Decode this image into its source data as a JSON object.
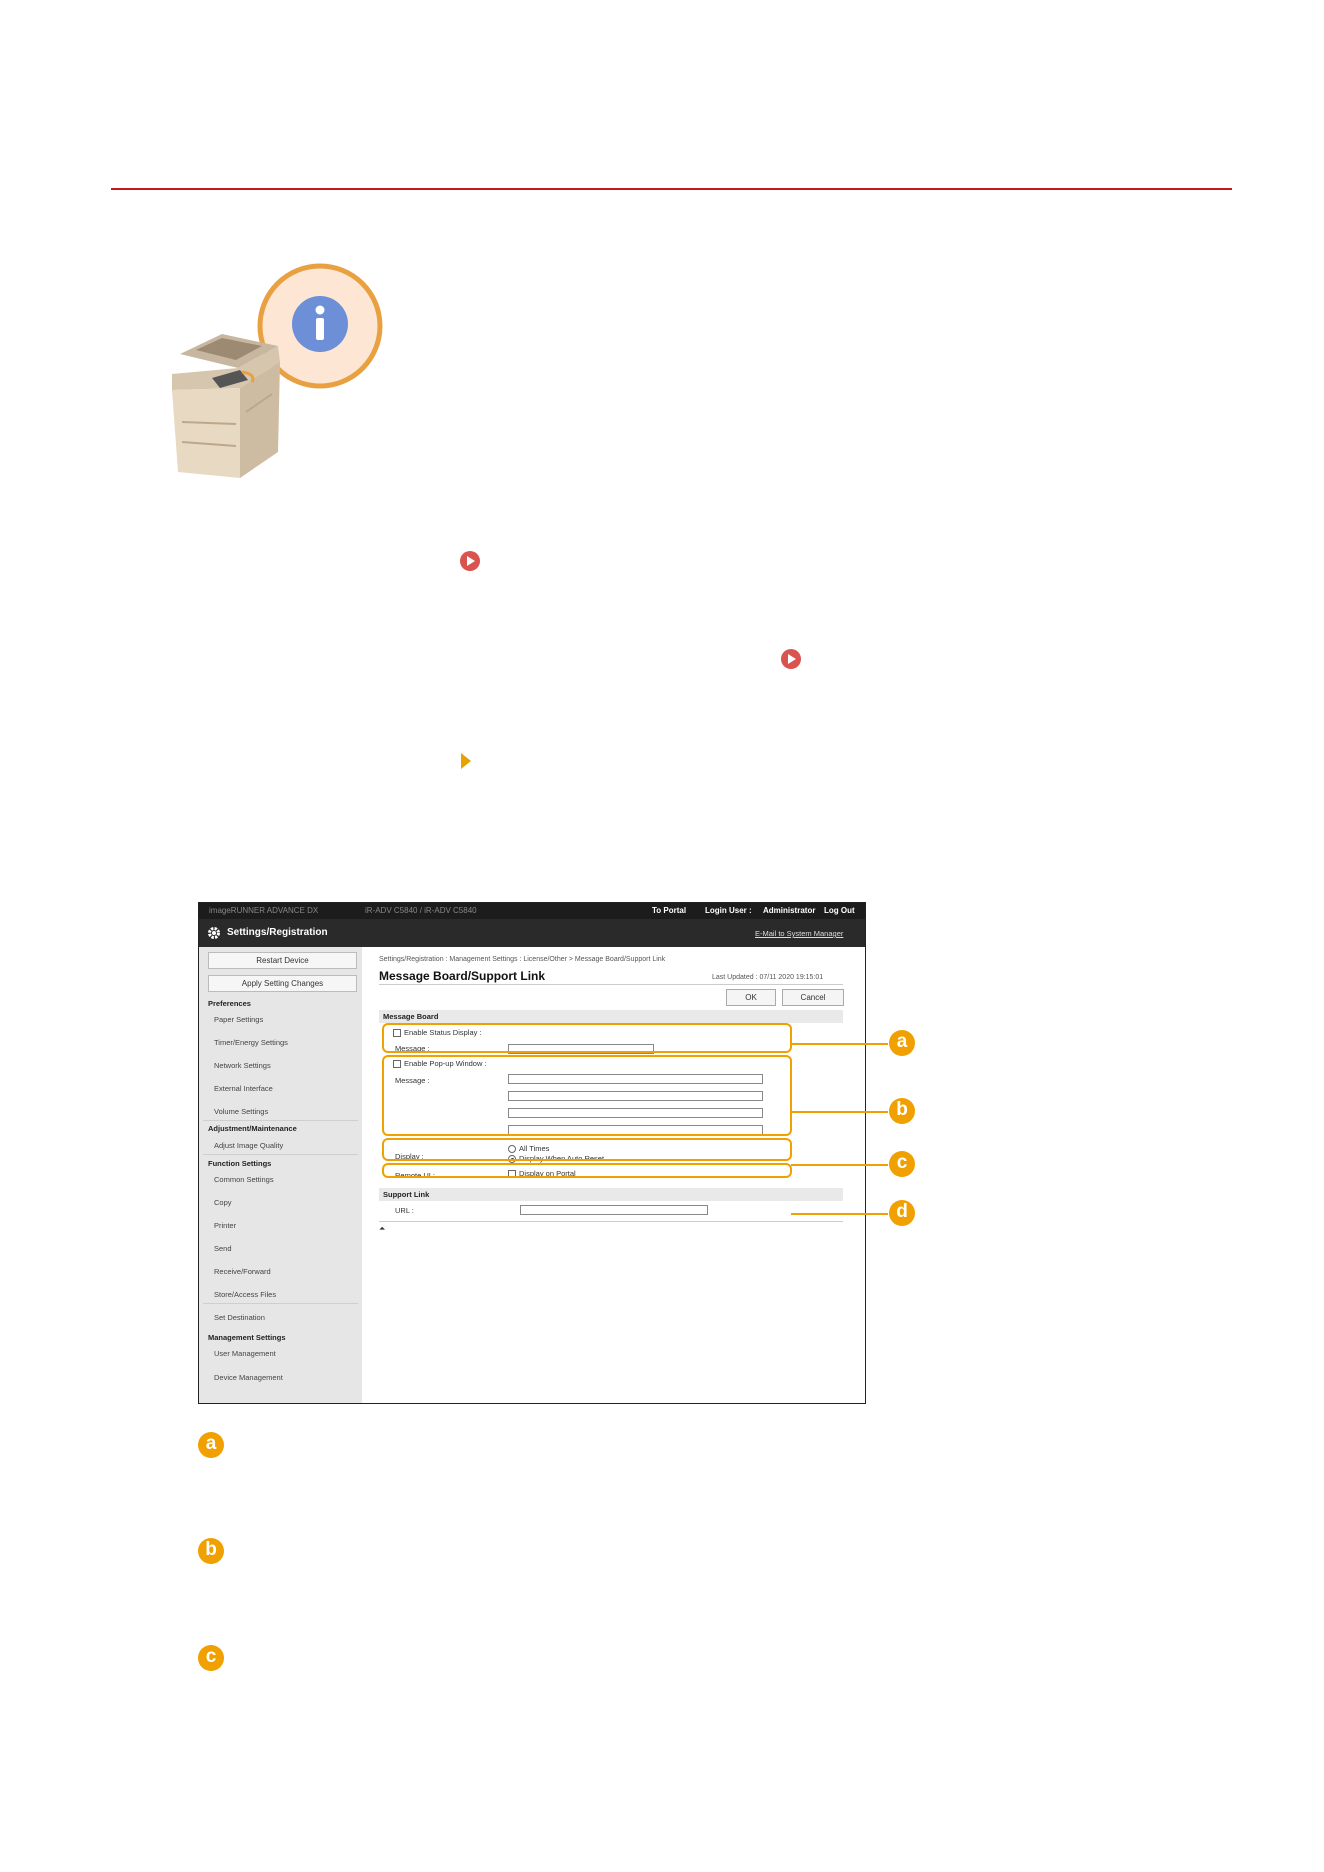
{
  "screenshot": {
    "topbar": {
      "product": "imageRUNNER ADVANCE DX",
      "host": "iR-ADV C5840 / iR-ADV C5840",
      "to_portal": "To Portal",
      "login_user": "Login User :",
      "user_name": "Administrator",
      "log_out": "Log Out"
    },
    "titlebar": {
      "title": "Settings/Registration",
      "email_link": "E-Mail to System Manager"
    },
    "sidebar": {
      "restart_button": "Restart Device",
      "apply_button": "Apply Setting Changes",
      "groups": [
        {
          "heading": "Preferences",
          "items": [
            "Paper Settings",
            "Timer/Energy Settings",
            "Network Settings",
            "External Interface",
            "Volume Settings"
          ]
        },
        {
          "heading": "Adjustment/Maintenance",
          "items": [
            "Adjust Image Quality"
          ]
        },
        {
          "heading": "Function Settings",
          "items": [
            "Common Settings",
            "Copy",
            "Printer",
            "Send",
            "Receive/Forward",
            "Store/Access Files",
            "Set Destination"
          ]
        },
        {
          "heading": "Management Settings",
          "items": [
            "User Management",
            "Device Management"
          ]
        }
      ]
    },
    "main": {
      "breadcrumb": "Settings/Registration : Management Settings : License/Other > Message Board/Support Link",
      "page_title": "Message Board/Support Link",
      "last_updated": "Last Updated : 07/11 2020 19:15:01",
      "ok_button": "OK",
      "cancel_button": "Cancel",
      "message_board_heading": "Message Board",
      "enable_status_display": "Enable Status Display :",
      "message_label_1": "Message :",
      "enable_popup": "Enable Pop-up Window :",
      "message_label_2": "Message :",
      "display_label": "Display :",
      "all_times": "All Times",
      "display_when_auto_reset": "Display When Auto Reset",
      "remote_ui_label": "Remote UI :",
      "display_on_portal": "Display on Portal",
      "support_link_heading": "Support Link",
      "url_label": "URL :"
    },
    "callouts": [
      "a",
      "b",
      "c",
      "d"
    ]
  },
  "legend": [
    "a",
    "b",
    "c"
  ],
  "colors": {
    "accent_rule": "#c8161d",
    "callout": "#f0a000",
    "link_icon": "#d9534f"
  }
}
